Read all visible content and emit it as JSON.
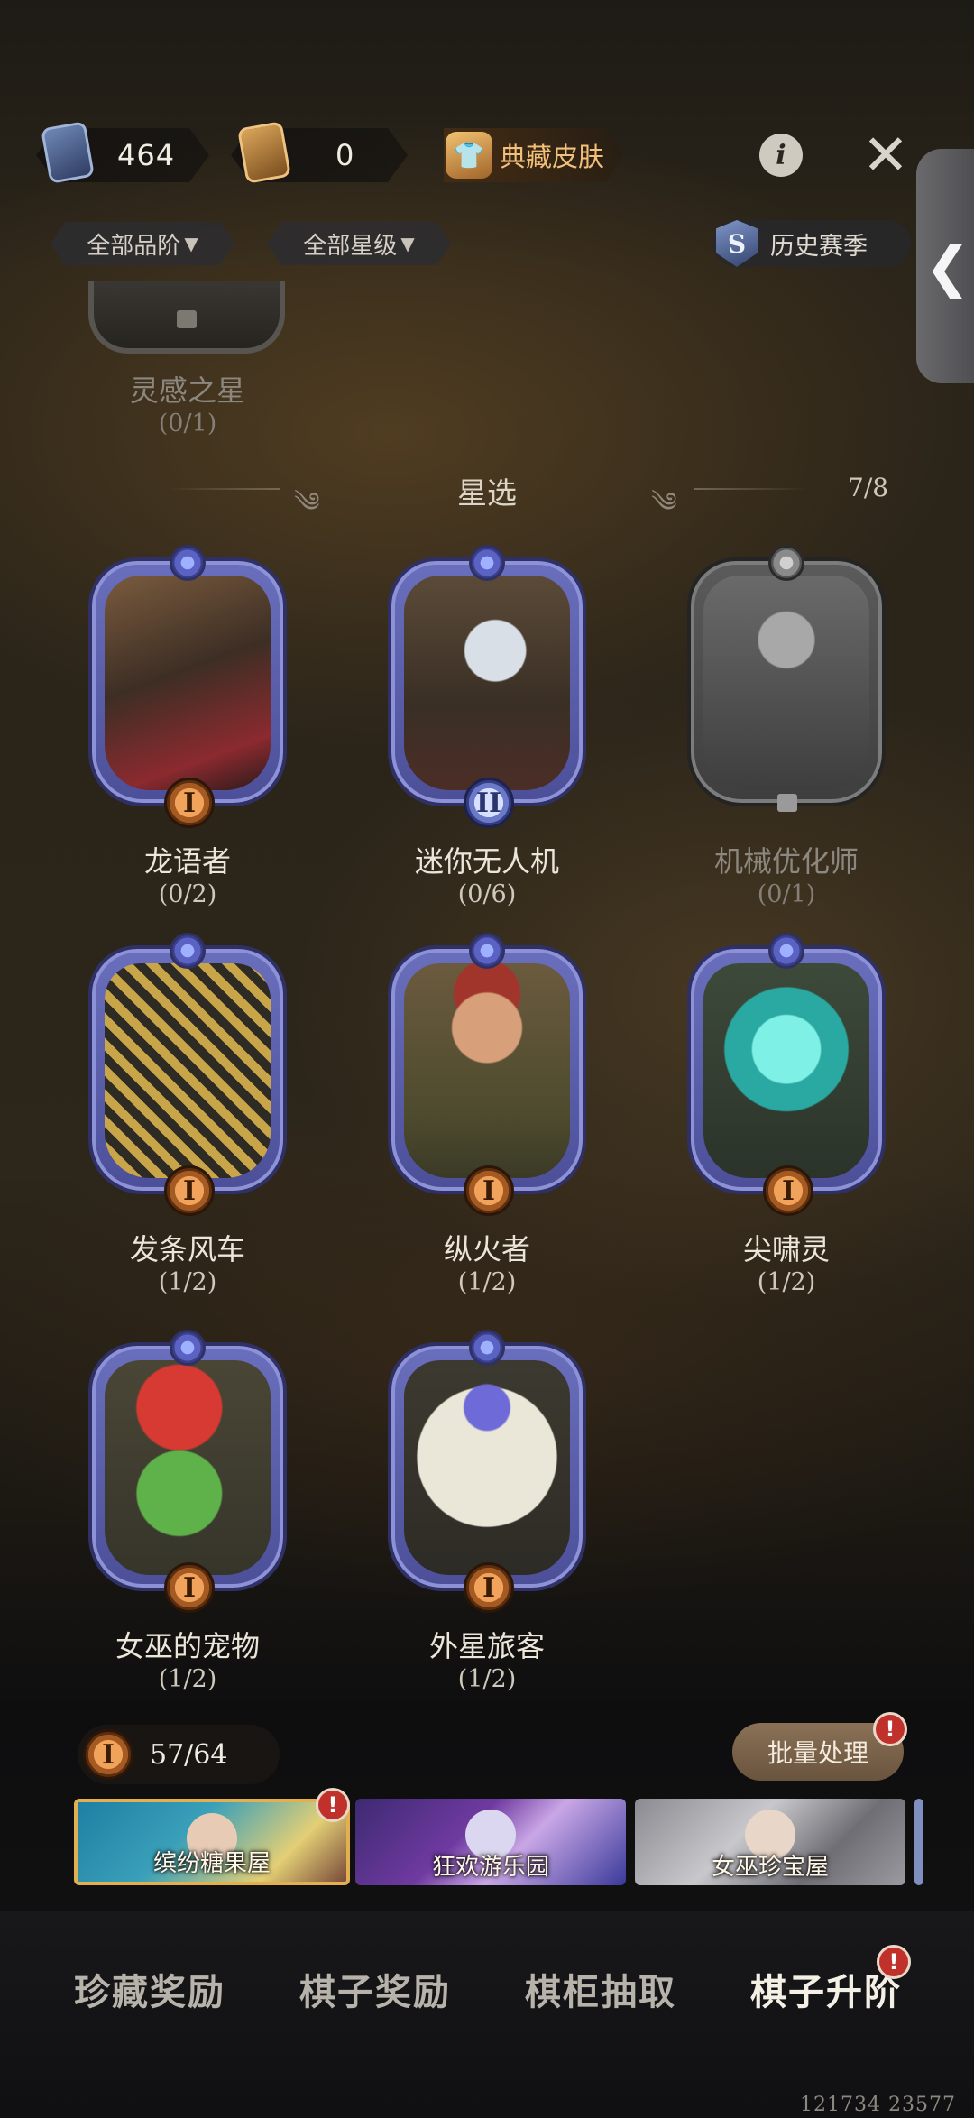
{
  "currency": {
    "cards_value": "464",
    "gold_value": "0",
    "collection_label": "典藏皮肤"
  },
  "icons": {
    "info": "i",
    "close": "✕",
    "side_tab": "❮",
    "season_badge": "S"
  },
  "filters": {
    "quality": "全部品阶",
    "star": "全部星级",
    "history": "历史赛季"
  },
  "partial_item": {
    "name": "灵感之星",
    "count": "(0/1)"
  },
  "section": {
    "title": "星选",
    "count": "7/8"
  },
  "items": [
    {
      "name": "龙语者",
      "count": "(0/2)",
      "tier": "I"
    },
    {
      "name": "迷你无人机",
      "count": "(0/6)",
      "tier": "II"
    },
    {
      "name": "机械优化师",
      "count": "(0/1)",
      "tier": ""
    },
    {
      "name": "发条风车",
      "count": "(1/2)",
      "tier": "I"
    },
    {
      "name": "纵火者",
      "count": "(1/2)",
      "tier": "I"
    },
    {
      "name": "尖啸灵",
      "count": "(1/2)",
      "tier": "I"
    },
    {
      "name": "女巫的宠物",
      "count": "(1/2)",
      "tier": "I"
    },
    {
      "name": "外星旅客",
      "count": "(1/2)",
      "tier": "I"
    }
  ],
  "progress": {
    "tier": "I",
    "value": "57/64"
  },
  "batch_label": "批量处理",
  "alert_mark": "!",
  "banners": [
    "缤纷糖果屋",
    "狂欢游乐园",
    "女巫珍宝屋"
  ],
  "nav": [
    "珍藏奖励",
    "棋子奖励",
    "棋柜抽取",
    "棋子升阶"
  ],
  "footer_id": "121734 23577"
}
